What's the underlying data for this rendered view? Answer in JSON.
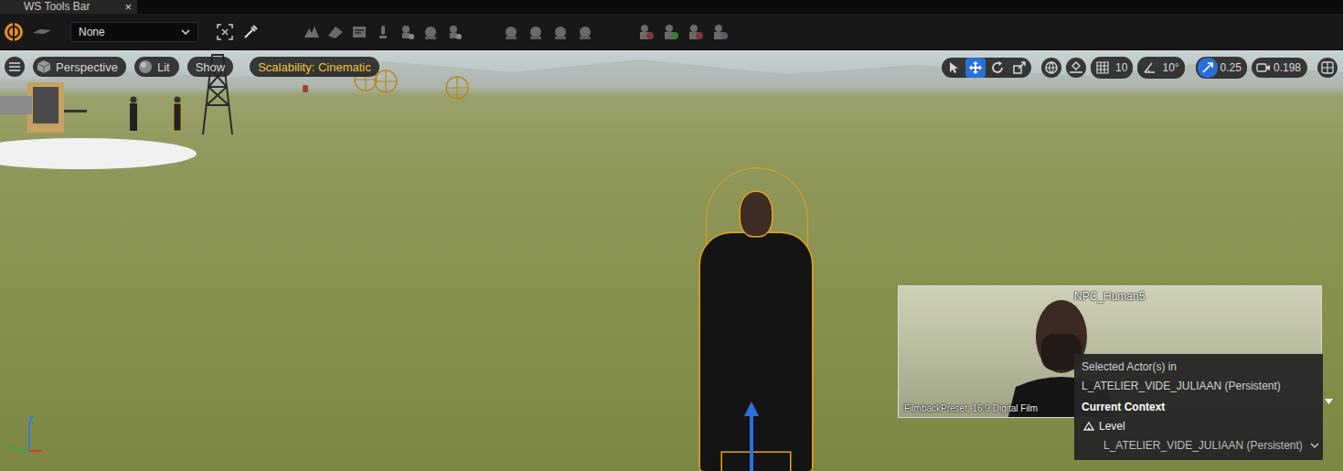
{
  "tab": {
    "label": "WS Tools Bar",
    "close": "×"
  },
  "toolbar": {
    "dropdown": {
      "value": "None"
    }
  },
  "viewport": {
    "left_buttons": [
      {
        "kind": "view",
        "label": "Perspective"
      },
      {
        "kind": "lighting",
        "label": "Lit"
      },
      {
        "kind": "show",
        "label": "Show"
      },
      {
        "kind": "scalability",
        "label": "Scalability: Cinematic"
      }
    ],
    "transform_tools": [
      {
        "kind": "select",
        "selected": false
      },
      {
        "kind": "translate",
        "selected": true
      },
      {
        "kind": "rotate",
        "selected": false
      },
      {
        "kind": "scale",
        "selected": false
      }
    ],
    "snaps": [
      {
        "kind": "grid",
        "value": "10",
        "on": false
      },
      {
        "kind": "angle",
        "value": "10°",
        "on": false
      },
      {
        "kind": "scale",
        "value": "0.25",
        "on": true
      }
    ],
    "camera_speed": "0.198",
    "axis_label": "Z"
  },
  "preview": {
    "label": "NPC_Human5",
    "info": "FilmbackPreset: 16:9 Digital Film"
  },
  "tooltip": {
    "heading": "Selected Actor(s) in",
    "level": "L_ATELIER_VIDE_JULIAAN (Persistent)",
    "context_label": "Current Context",
    "context_kind": "Level",
    "context_value": "L_ATELIER_VIDE_JULIAAN (Persistent)"
  }
}
